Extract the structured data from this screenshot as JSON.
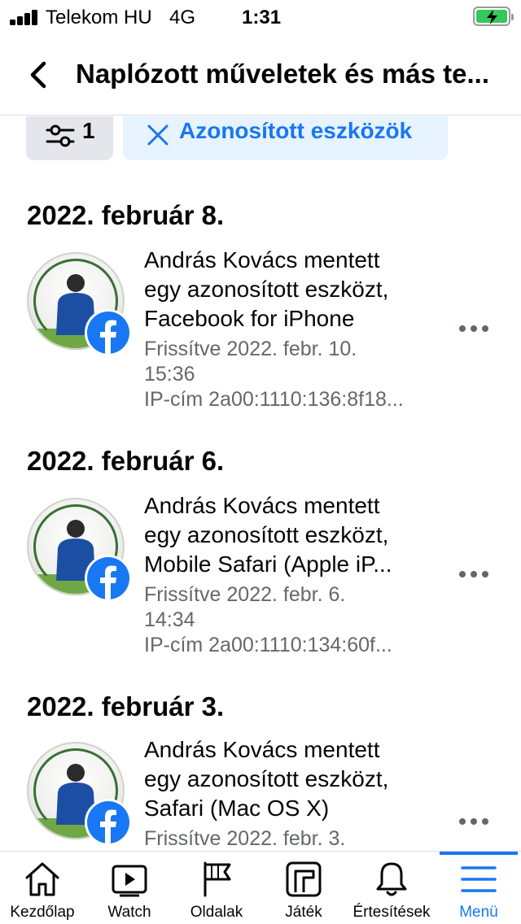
{
  "status_bar": {
    "carrier": "Telekom HU",
    "network": "4G",
    "time": "1:31"
  },
  "header": {
    "title": "Naplózott műveletek és más te..."
  },
  "filters": {
    "filter_count": "1",
    "active_chip_label": "Azonosított eszközök"
  },
  "entries": [
    {
      "date": "2022. február 8.",
      "title_lines": [
        "András Kovács mentett",
        "egy azonosított eszközt,",
        "Facebook for iPhone"
      ],
      "updated_lines": [
        "Frissítve 2022. febr. 10.",
        "15:36"
      ],
      "ip": "IP-cím 2a00:1110:136:8f18..."
    },
    {
      "date": "2022. február 6.",
      "title_lines": [
        "András Kovács mentett",
        "egy azonosított eszközt,",
        "Mobile Safari (Apple iP..."
      ],
      "updated_lines": [
        "Frissítve 2022. febr. 6.",
        "14:34"
      ],
      "ip": "IP-cím 2a00:1110:134:60f..."
    },
    {
      "date": "2022. február 3.",
      "title_lines": [
        "András Kovács mentett",
        "egy azonosított eszközt,",
        "Safari (Mac OS X)"
      ],
      "updated_lines": [
        "Frissítve 2022. febr. 3.",
        ""
      ],
      "ip": ""
    }
  ],
  "tabs": [
    {
      "label": "Kezdőlap",
      "icon": "home-icon",
      "active": false
    },
    {
      "label": "Watch",
      "icon": "watch-icon",
      "active": false
    },
    {
      "label": "Oldalak",
      "icon": "flag-icon",
      "active": false
    },
    {
      "label": "Játék",
      "icon": "gaming-icon",
      "active": false
    },
    {
      "label": "Értesítések",
      "icon": "bell-icon",
      "active": false
    },
    {
      "label": "Menü",
      "icon": "menu-icon",
      "active": true
    }
  ],
  "colors": {
    "accent": "#1877f2",
    "chip_active_bg": "#e7f3ff",
    "chip_bg": "#e4e6eb",
    "secondary_text": "#65676b",
    "battery": "#35c759"
  }
}
